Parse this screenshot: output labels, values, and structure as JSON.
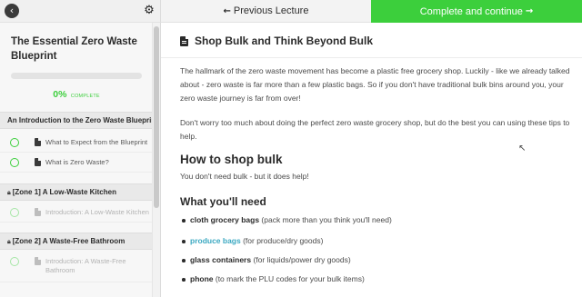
{
  "topbar": {
    "back_icon": "chevron-left-icon",
    "settings_icon": "gear-icon",
    "prev_label": "Previous Lecture",
    "prev_arrow": "←",
    "next_label": "Complete and continue",
    "next_arrow": "→",
    "accent": "#3ccf3c"
  },
  "sidebar": {
    "course_title": "The Essential Zero Waste Blueprint",
    "progress_fraction": 0.0,
    "progress_pct": "0%",
    "progress_word": "COMPLETE",
    "sections": [
      {
        "title": "An Introduction to the Zero Waste Blueprint",
        "locked": false,
        "lessons": [
          "What to Expect from the Blueprint",
          "What is Zero Waste?"
        ]
      },
      {
        "title": "[Zone 1] A Low-Waste Kitchen",
        "locked": true,
        "lessons": [
          "Introduction: A Low-Waste Kitchen"
        ]
      },
      {
        "title": "[Zone 2] A Waste-Free Bathroom",
        "locked": true,
        "lessons": [
          "Introduction: A Waste-Free Bathroom"
        ]
      }
    ]
  },
  "main": {
    "lecture_title": "Shop Bulk and Think Beyond Bulk",
    "intro_p1": "The hallmark of the zero waste movement has become a plastic free grocery shop. Luckily - like we already talked about - zero waste is far more than a few plastic bags. So if you don't have traditional bulk bins around you, your zero waste journey is far from over!",
    "intro_p2": "Don't worry too much about doing the perfect zero waste grocery shop, but do the best you can using these tips to help.",
    "h_how": "How to shop bulk",
    "p_how": "You don't need bulk - but it does help!",
    "h_need": "What you'll need",
    "items": [
      {
        "bold": "cloth grocery bags",
        "rest": " (pack more than you think you'll need)",
        "link": false
      },
      {
        "bold": "produce bags",
        "rest": " (for produce/dry goods)",
        "link": true
      },
      {
        "bold": "glass containers",
        "rest": " (for liquids/power dry goods)",
        "link": false
      },
      {
        "bold": "phone",
        "rest": " (to mark the PLU codes for your bulk items)",
        "link": false
      }
    ],
    "link_color": "#3aa8c1"
  }
}
